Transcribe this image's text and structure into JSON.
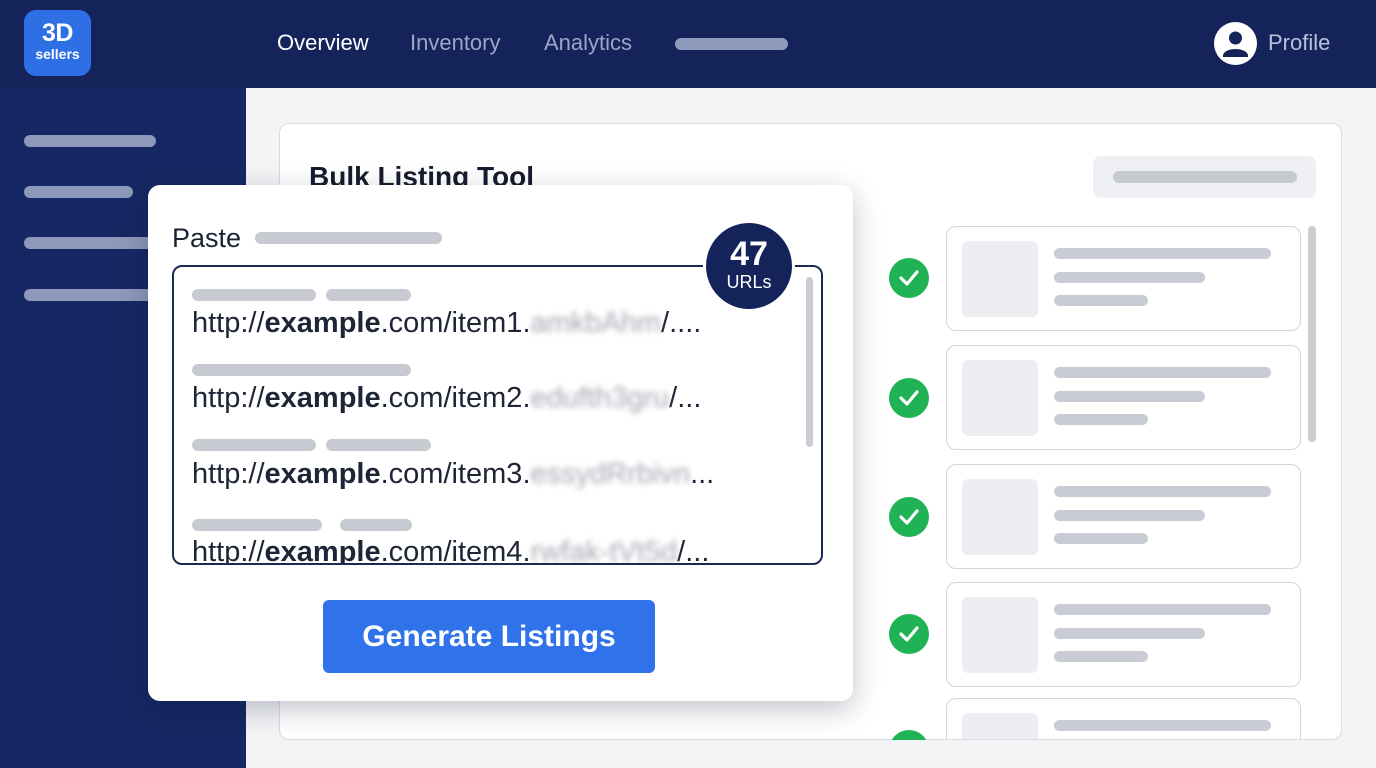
{
  "brand": {
    "line1": "3D",
    "line2": "sellers",
    "color": "#2f6fe6"
  },
  "nav": {
    "items": [
      {
        "label": "Overview",
        "active": true
      },
      {
        "label": "Inventory",
        "active": false
      },
      {
        "label": "Analytics",
        "active": false
      }
    ],
    "profile_label": "Profile"
  },
  "main": {
    "title": "Bulk Listing Tool"
  },
  "paste_panel": {
    "label": "Paste",
    "url_count": "47",
    "url_count_unit": "URLs",
    "urls": [
      {
        "prefix": "http://",
        "bold": "example",
        "middle": ".com/item1.",
        "blurred": "amkbAhm",
        "suffix": "/...."
      },
      {
        "prefix": "http://",
        "bold": "example",
        "middle": ".com/item2.",
        "blurred": "edufth3gru",
        "suffix": "/..."
      },
      {
        "prefix": "http://",
        "bold": "example",
        "middle": ".com/item3.",
        "blurred": "essydRrbivn",
        "suffix": "..."
      },
      {
        "prefix": "http://",
        "bold": "example",
        "middle": ".com/item4.",
        "blurred": "rwfak-tVt5d",
        "suffix": "/..."
      }
    ],
    "generate_label": "Generate Listings"
  },
  "colors": {
    "navy": "#14245a",
    "accent_blue": "#2f72ea",
    "success_green": "#1fb356"
  }
}
